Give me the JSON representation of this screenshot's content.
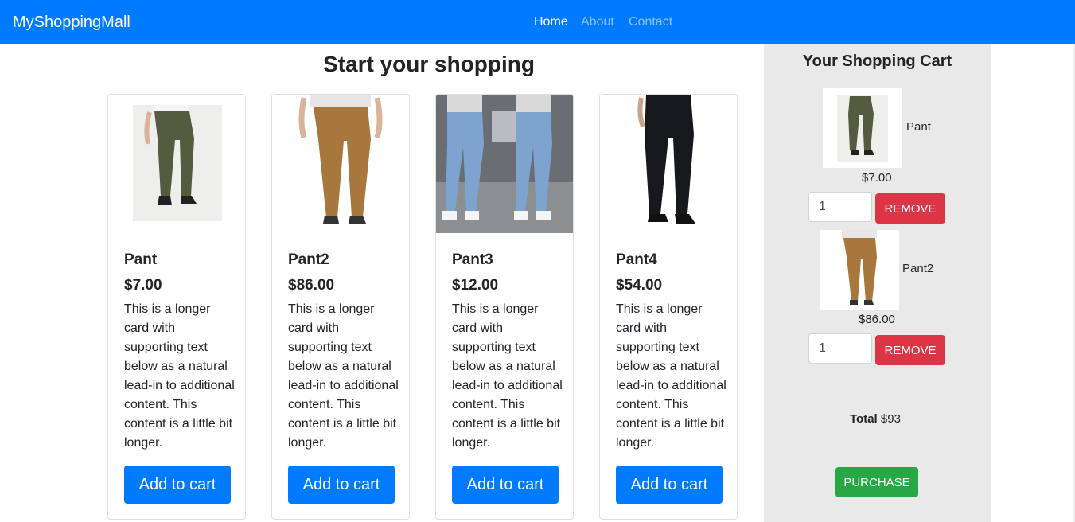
{
  "navbar": {
    "brand": "MyShoppingMall",
    "links": [
      {
        "label": "Home"
      },
      {
        "label": "About"
      },
      {
        "label": "Contact"
      }
    ]
  },
  "main": {
    "heading": "Start your shopping",
    "products": [
      {
        "title": "Pant",
        "price": "$7.00",
        "description": "This is a longer card with supporting text below as a natural lead-in to additional content. This content is a little bit longer.",
        "button_label": "Add to cart",
        "image_icon": "olive-pant-photo"
      },
      {
        "title": "Pant2",
        "price": "$86.00",
        "description": "This is a longer card with supporting text below as a natural lead-in to additional content. This content is a little bit longer.",
        "button_label": "Add to cart",
        "image_icon": "brown-pant-photo"
      },
      {
        "title": "Pant3",
        "price": "$12.00",
        "description": "This is a longer card with supporting text below as a natural lead-in to additional content. This content is a little bit longer.",
        "button_label": "Add to cart",
        "image_icon": "ripped-jeans-photo"
      },
      {
        "title": "Pant4",
        "price": "$54.00",
        "description": "This is a longer card with supporting text below as a natural lead-in to additional content. This content is a little bit longer.",
        "button_label": "Add to cart",
        "image_icon": "black-pant-photo"
      }
    ]
  },
  "cart": {
    "title": "Your Shopping Cart",
    "items": [
      {
        "name": "Pant",
        "price": "$7.00",
        "quantity": "1",
        "remove_label": "REMOVE"
      },
      {
        "name": "Pant2",
        "price": "$86.00",
        "quantity": "1",
        "remove_label": "REMOVE"
      }
    ],
    "total_label": "Total",
    "total_value": "$93",
    "purchase_label": "PURCHASE"
  },
  "colors": {
    "primary": "#007bff",
    "danger": "#dc3545",
    "success": "#28a745",
    "cart_bg": "#e9e9e9"
  }
}
